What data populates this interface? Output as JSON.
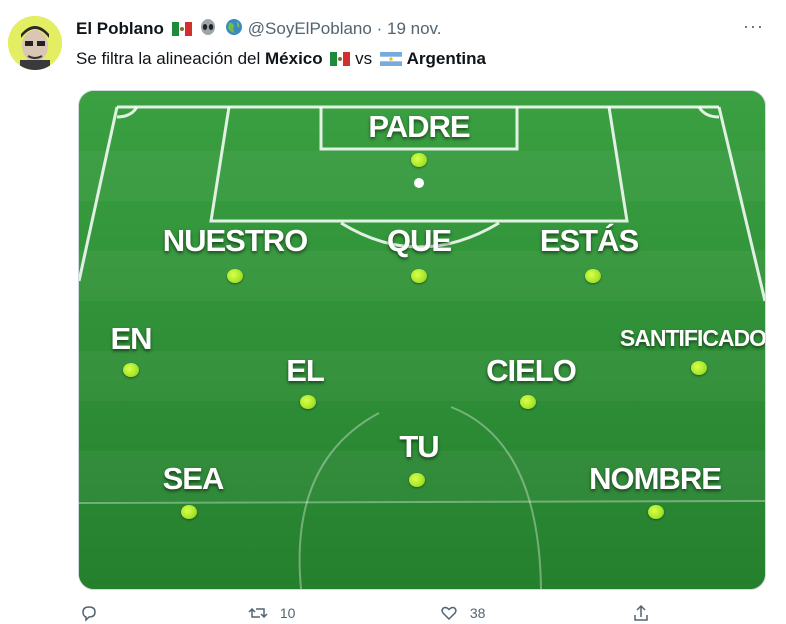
{
  "tweet": {
    "display_name": "El Poblano",
    "handle": "@SoyElPoblano",
    "separator": "·",
    "date": "19 nov.",
    "text_prefix": "Se filtra la alineación del ",
    "team_home": "México",
    "vs": "vs",
    "team_away": "Argentina",
    "more_label": "···"
  },
  "lineup": {
    "players": [
      "PADRE",
      "NUESTRO",
      "QUE",
      "ESTÁS",
      "EN",
      "EL",
      "CIELO",
      "SANTIFICADO",
      "TU",
      "SEA",
      "NOMBRE"
    ]
  },
  "actions": {
    "reply_count": "",
    "retweet_count": "10",
    "like_count": "38"
  },
  "icons": {
    "home_flag": "mexico-flag-icon",
    "away_flag": "argentina-flag-icon",
    "alien": "alien-icon",
    "globe": "globe-icon"
  }
}
